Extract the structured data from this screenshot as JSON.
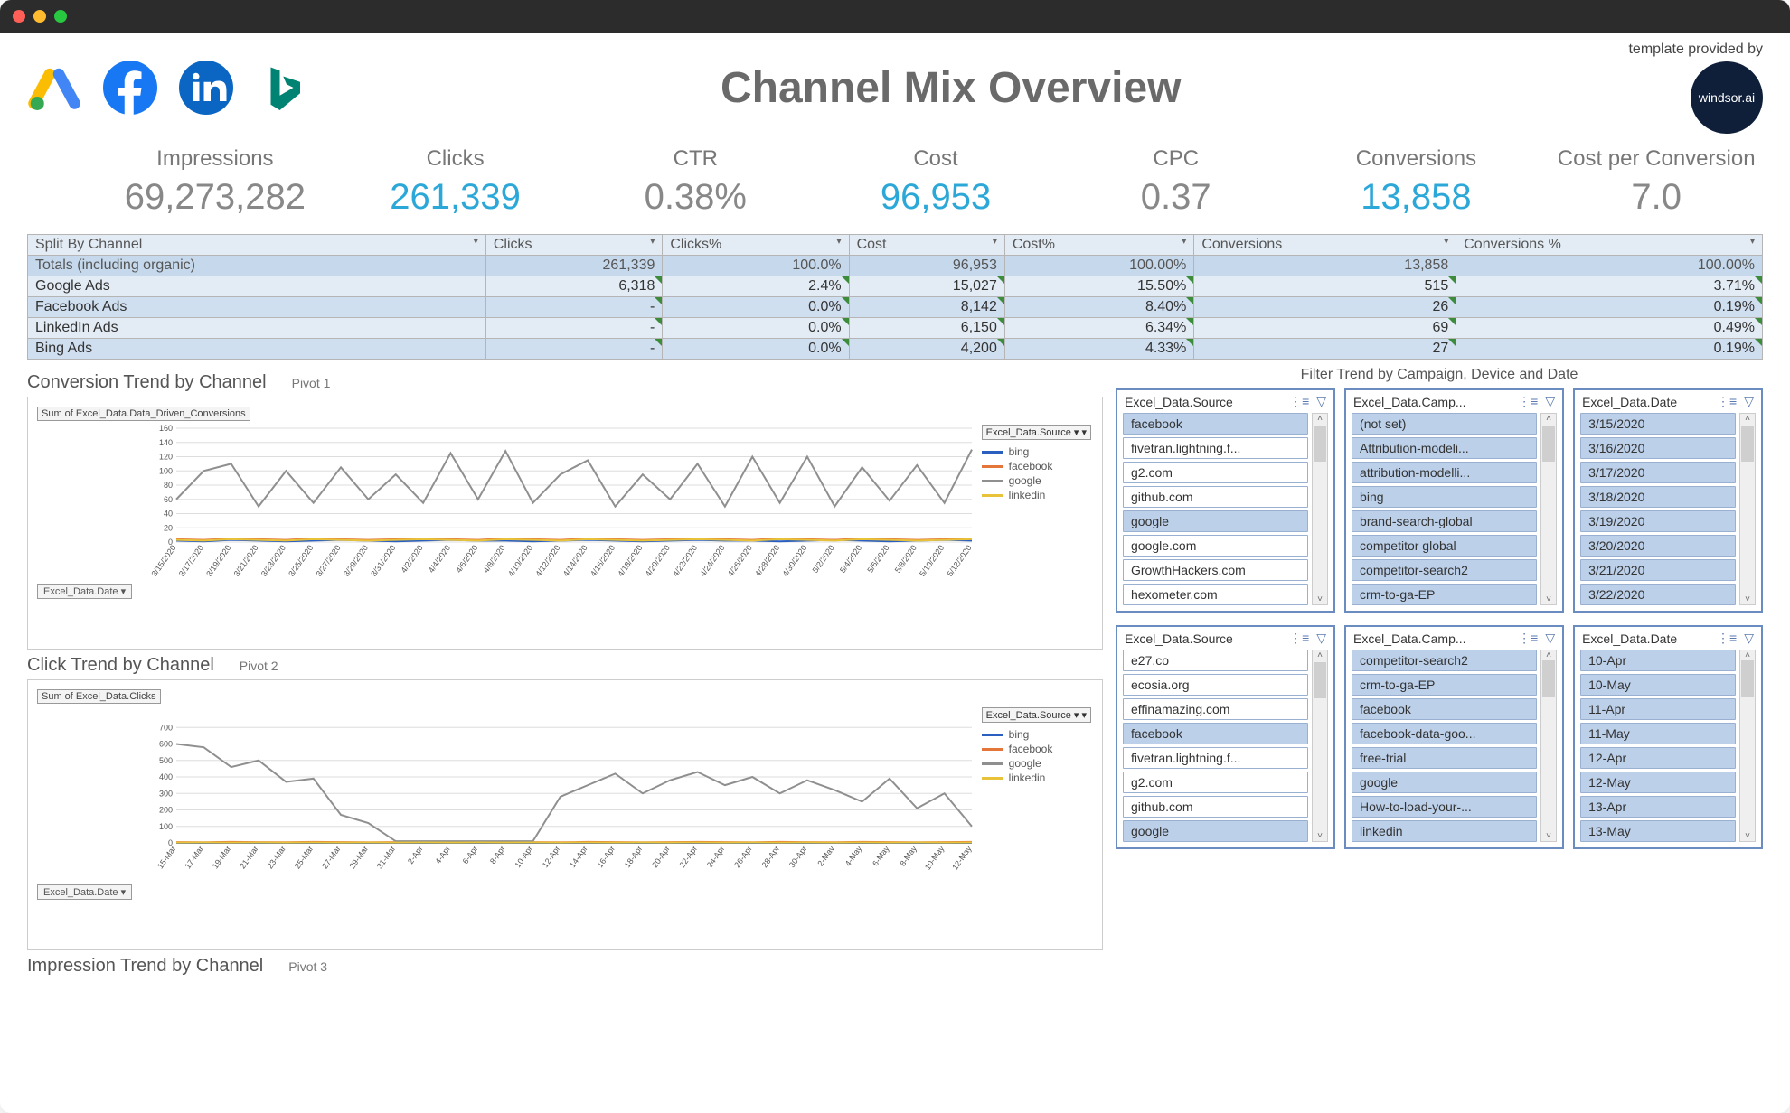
{
  "window": {
    "title": "Channel Mix Overview"
  },
  "template_note": "template provided by",
  "brand_badge": "windsor.ai",
  "kpis": [
    {
      "label": "Impressions",
      "value": "69,273,282",
      "color": "gray"
    },
    {
      "label": "Clicks",
      "value": "261,339",
      "color": "blue"
    },
    {
      "label": "CTR",
      "value": "0.38%",
      "color": "gray"
    },
    {
      "label": "Cost",
      "value": "96,953",
      "color": "blue"
    },
    {
      "label": "CPC",
      "value": "0.37",
      "color": "gray"
    },
    {
      "label": "Conversions",
      "value": "13,858",
      "color": "blue"
    },
    {
      "label": "Cost per Conversion",
      "value": "7.0",
      "color": "gray"
    }
  ],
  "table": {
    "headers": [
      "Split By Channel",
      "Clicks",
      "Clicks%",
      "Cost",
      "Cost%",
      "Conversions",
      "Conversions %"
    ],
    "totals_label": "Totals (including organic)",
    "rows": [
      {
        "channel": "Totals (including organic)",
        "clicks": "261,339",
        "clicks_pct": "100.0%",
        "cost": "96,953",
        "cost_pct": "100.00%",
        "conv": "13,858",
        "conv_pct": "100.00%",
        "totals": true
      },
      {
        "channel": "Google Ads",
        "clicks": "6,318",
        "clicks_pct": "2.4%",
        "cost": "15,027",
        "cost_pct": "15.50%",
        "conv": "515",
        "conv_pct": "3.71%"
      },
      {
        "channel": "Facebook Ads",
        "clicks": "-",
        "clicks_pct": "0.0%",
        "cost": "8,142",
        "cost_pct": "8.40%",
        "conv": "26",
        "conv_pct": "0.19%"
      },
      {
        "channel": "LinkedIn Ads",
        "clicks": "-",
        "clicks_pct": "0.0%",
        "cost": "6,150",
        "cost_pct": "6.34%",
        "conv": "69",
        "conv_pct": "0.49%"
      },
      {
        "channel": "Bing Ads",
        "clicks": "-",
        "clicks_pct": "0.0%",
        "cost": "4,200",
        "cost_pct": "4.33%",
        "conv": "27",
        "conv_pct": "0.19%"
      }
    ]
  },
  "filter_title": "Filter Trend by Campaign, Device and Date",
  "charts": {
    "conv": {
      "title": "Conversion Trend by Channel",
      "pivot": "Pivot 1",
      "sub": "Sum of Excel_Data.Data_Driven_Conversions",
      "filter_pill": "Excel_Data.Date ▾",
      "legend_title": "Excel_Data.Source ▾",
      "series": [
        "bing",
        "facebook",
        "google",
        "linkedin"
      ],
      "colors": {
        "bing": "#2b5fbf",
        "facebook": "#e5763a",
        "google": "#8f8f8f",
        "linkedin": "#e8c33a"
      }
    },
    "click": {
      "title": "Click Trend by Channel",
      "pivot": "Pivot 2",
      "sub": "Sum of Excel_Data.Clicks",
      "filter_pill": "Excel_Data.Date ▾",
      "legend_title": "Excel_Data.Source ▾",
      "series": [
        "bing",
        "facebook",
        "google",
        "linkedin"
      ],
      "colors": {
        "bing": "#2b5fbf",
        "facebook": "#e5763a",
        "google": "#8f8f8f",
        "linkedin": "#e8c33a"
      }
    },
    "impr": {
      "title": "Impression Trend by Channel",
      "pivot": "Pivot 3"
    }
  },
  "slicers_top": {
    "source": {
      "title": "Excel_Data.Source",
      "items": [
        {
          "label": "facebook",
          "sel": true
        },
        {
          "label": "fivetran.lightning.f...",
          "sel": false
        },
        {
          "label": "g2.com",
          "sel": false
        },
        {
          "label": "github.com",
          "sel": false
        },
        {
          "label": "google",
          "sel": true
        },
        {
          "label": "google.com",
          "sel": false
        },
        {
          "label": "GrowthHackers.com",
          "sel": false
        },
        {
          "label": "hexometer.com",
          "sel": false
        }
      ]
    },
    "camp": {
      "title": "Excel_Data.Camp...",
      "items": [
        {
          "label": "(not set)",
          "sel": true
        },
        {
          "label": "Attribution-modeli...",
          "sel": true
        },
        {
          "label": "attribution-modelli...",
          "sel": true
        },
        {
          "label": "bing",
          "sel": true
        },
        {
          "label": "brand-search-global",
          "sel": true
        },
        {
          "label": "competitor global",
          "sel": true
        },
        {
          "label": "competitor-search2",
          "sel": true
        },
        {
          "label": "crm-to-ga-EP",
          "sel": true
        }
      ]
    },
    "date": {
      "title": "Excel_Data.Date",
      "items": [
        {
          "label": "3/15/2020",
          "sel": true
        },
        {
          "label": "3/16/2020",
          "sel": true
        },
        {
          "label": "3/17/2020",
          "sel": true
        },
        {
          "label": "3/18/2020",
          "sel": true
        },
        {
          "label": "3/19/2020",
          "sel": true
        },
        {
          "label": "3/20/2020",
          "sel": true
        },
        {
          "label": "3/21/2020",
          "sel": true
        },
        {
          "label": "3/22/2020",
          "sel": true
        }
      ]
    }
  },
  "slicers_bottom": {
    "source": {
      "title": "Excel_Data.Source",
      "items": [
        {
          "label": "e27.co",
          "sel": false
        },
        {
          "label": "ecosia.org",
          "sel": false
        },
        {
          "label": "effinamazing.com",
          "sel": false
        },
        {
          "label": "facebook",
          "sel": true
        },
        {
          "label": "fivetran.lightning.f...",
          "sel": false
        },
        {
          "label": "g2.com",
          "sel": false
        },
        {
          "label": "github.com",
          "sel": false
        },
        {
          "label": "google",
          "sel": true
        }
      ]
    },
    "camp": {
      "title": "Excel_Data.Camp...",
      "items": [
        {
          "label": "competitor-search2",
          "sel": true
        },
        {
          "label": "crm-to-ga-EP",
          "sel": true
        },
        {
          "label": "facebook",
          "sel": true
        },
        {
          "label": "facebook-data-goo...",
          "sel": true
        },
        {
          "label": "free-trial",
          "sel": true
        },
        {
          "label": "google",
          "sel": true
        },
        {
          "label": "How-to-load-your-...",
          "sel": true
        },
        {
          "label": "linkedin",
          "sel": true
        }
      ]
    },
    "date": {
      "title": "Excel_Data.Date",
      "items": [
        {
          "label": "10-Apr",
          "sel": true
        },
        {
          "label": "10-May",
          "sel": true
        },
        {
          "label": "11-Apr",
          "sel": true
        },
        {
          "label": "11-May",
          "sel": true
        },
        {
          "label": "12-Apr",
          "sel": true
        },
        {
          "label": "12-May",
          "sel": true
        },
        {
          "label": "13-Apr",
          "sel": true
        },
        {
          "label": "13-May",
          "sel": true
        }
      ]
    }
  },
  "chart_data": [
    {
      "type": "line",
      "title": "Conversion Trend by Channel",
      "ylabel": "Sum of Excel_Data.Data_Driven_Conversions",
      "ylim": [
        0,
        160
      ],
      "yticks": [
        0,
        20,
        40,
        60,
        80,
        100,
        120,
        140,
        160
      ],
      "x": [
        "3/15/2020",
        "3/17/2020",
        "3/19/2020",
        "3/21/2020",
        "3/23/2020",
        "3/25/2020",
        "3/27/2020",
        "3/29/2020",
        "3/31/2020",
        "4/2/2020",
        "4/4/2020",
        "4/6/2020",
        "4/8/2020",
        "4/10/2020",
        "4/12/2020",
        "4/14/2020",
        "4/16/2020",
        "4/18/2020",
        "4/20/2020",
        "4/22/2020",
        "4/24/2020",
        "4/26/2020",
        "4/28/2020",
        "4/30/2020",
        "5/2/2020",
        "5/4/2020",
        "5/6/2020",
        "5/8/2020",
        "5/10/2020",
        "5/12/2020"
      ],
      "series": [
        {
          "name": "bing",
          "values": [
            2,
            1,
            3,
            2,
            1,
            2,
            3,
            2,
            1,
            2,
            3,
            2,
            2,
            1,
            2,
            3,
            2,
            1,
            2,
            3,
            2,
            2,
            1,
            2,
            3,
            2,
            1,
            2,
            3,
            2
          ]
        },
        {
          "name": "facebook",
          "values": [
            4,
            3,
            5,
            4,
            3,
            5,
            4,
            3,
            4,
            5,
            4,
            3,
            5,
            4,
            3,
            5,
            4,
            3,
            4,
            5,
            4,
            3,
            5,
            4,
            3,
            5,
            4,
            3,
            4,
            5
          ]
        },
        {
          "name": "google",
          "values": [
            60,
            100,
            110,
            50,
            100,
            55,
            105,
            60,
            95,
            55,
            125,
            60,
            128,
            55,
            95,
            115,
            50,
            95,
            60,
            110,
            50,
            120,
            55,
            120,
            50,
            105,
            58,
            108,
            55,
            130
          ]
        },
        {
          "name": "linkedin",
          "values": [
            3,
            2,
            4,
            3,
            2,
            4,
            3,
            2,
            3,
            4,
            3,
            2,
            4,
            3,
            2,
            4,
            3,
            2,
            3,
            4,
            3,
            2,
            4,
            3,
            2,
            4,
            3,
            2,
            3,
            4
          ]
        }
      ]
    },
    {
      "type": "line",
      "title": "Click Trend by Channel",
      "ylabel": "Sum of Excel_Data.Clicks",
      "ylim": [
        0,
        800
      ],
      "yticks": [
        0,
        100,
        200,
        300,
        400,
        500,
        600,
        700
      ],
      "x": [
        "15-Mar",
        "17-Mar",
        "19-Mar",
        "21-Mar",
        "23-Mar",
        "25-Mar",
        "27-Mar",
        "29-Mar",
        "31-Mar",
        "2-Apr",
        "4-Apr",
        "6-Apr",
        "8-Apr",
        "10-Apr",
        "12-Apr",
        "14-Apr",
        "16-Apr",
        "18-Apr",
        "20-Apr",
        "22-Apr",
        "24-Apr",
        "26-Apr",
        "28-Apr",
        "30-Apr",
        "2-May",
        "4-May",
        "6-May",
        "8-May",
        "10-May",
        "12-May"
      ],
      "series": [
        {
          "name": "bing",
          "values": [
            0,
            0,
            0,
            0,
            0,
            0,
            0,
            0,
            0,
            0,
            0,
            0,
            0,
            0,
            0,
            0,
            0,
            0,
            0,
            0,
            0,
            0,
            0,
            0,
            0,
            0,
            0,
            0,
            0,
            0
          ]
        },
        {
          "name": "facebook",
          "values": [
            5,
            4,
            6,
            5,
            4,
            6,
            5,
            4,
            5,
            6,
            5,
            4,
            6,
            5,
            4,
            6,
            5,
            4,
            5,
            6,
            5,
            4,
            6,
            5,
            4,
            6,
            5,
            4,
            5,
            6
          ]
        },
        {
          "name": "google",
          "values": [
            600,
            580,
            460,
            500,
            370,
            390,
            170,
            120,
            10,
            10,
            10,
            10,
            10,
            10,
            280,
            350,
            420,
            300,
            380,
            430,
            350,
            400,
            300,
            380,
            320,
            250,
            390,
            210,
            300,
            100
          ]
        },
        {
          "name": "linkedin",
          "values": [
            2,
            3,
            2,
            3,
            2,
            3,
            2,
            3,
            2,
            3,
            2,
            3,
            2,
            3,
            2,
            3,
            2,
            3,
            2,
            3,
            2,
            3,
            2,
            3,
            2,
            3,
            2,
            3,
            2,
            3
          ]
        }
      ]
    }
  ]
}
